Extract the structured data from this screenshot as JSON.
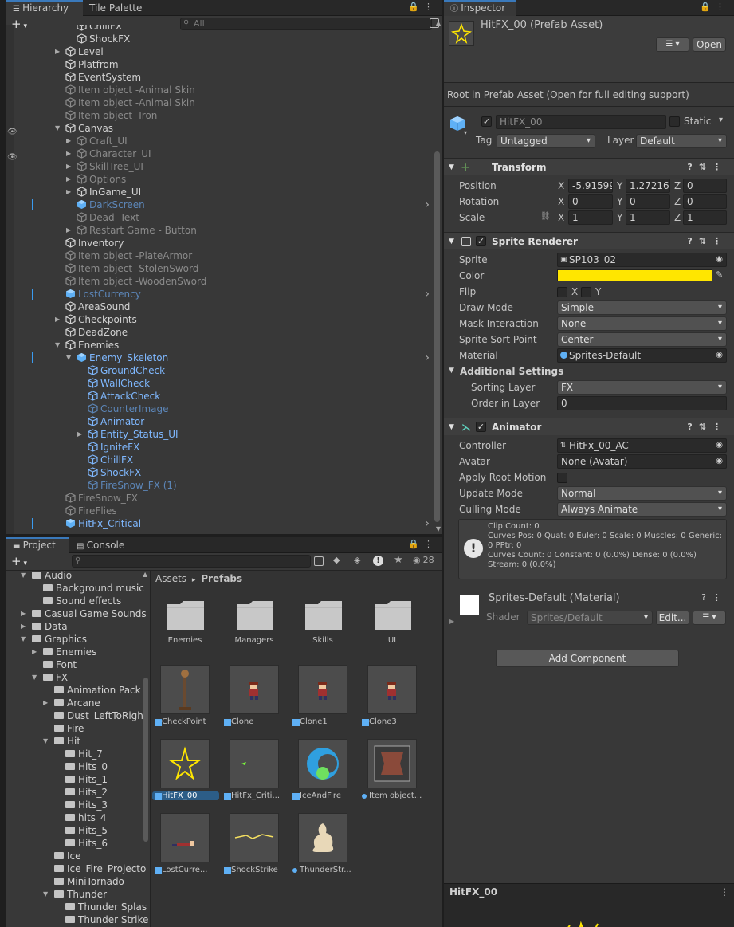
{
  "hierarchy": {
    "tabs": [
      "Hierarchy",
      "Tile Palette"
    ],
    "search_placeholder": "All",
    "items": [
      {
        "label": "ChillFX",
        "indent": 3,
        "style": "norm",
        "arrow": false
      },
      {
        "label": "ShockFX",
        "indent": 3,
        "style": "norm",
        "arrow": false
      },
      {
        "label": "Level",
        "indent": 2,
        "style": "norm",
        "arrow": true
      },
      {
        "label": "Platfrom",
        "indent": 2,
        "style": "norm",
        "arrow": false
      },
      {
        "label": "EventSystem",
        "indent": 2,
        "style": "norm",
        "arrow": false
      },
      {
        "label": "Item object -Animal Skin",
        "indent": 2,
        "style": "dim",
        "arrow": false
      },
      {
        "label": "Item object -Animal Skin",
        "indent": 2,
        "style": "dim",
        "arrow": false
      },
      {
        "label": "Item object -Iron",
        "indent": 2,
        "style": "dim",
        "arrow": false
      },
      {
        "label": "Canvas",
        "indent": 2,
        "style": "norm",
        "arrow": true,
        "open": true
      },
      {
        "label": "Craft_UI",
        "indent": 3,
        "style": "dim",
        "arrow": true
      },
      {
        "label": "Character_UI",
        "indent": 3,
        "style": "dim",
        "arrow": true
      },
      {
        "label": "SkillTree_UI",
        "indent": 3,
        "style": "dim",
        "arrow": true
      },
      {
        "label": "Options",
        "indent": 3,
        "style": "dim",
        "arrow": true
      },
      {
        "label": "InGame_UI",
        "indent": 3,
        "style": "norm",
        "arrow": true
      },
      {
        "label": "DarkScreen",
        "indent": 3,
        "style": "dimblue",
        "arrow": false,
        "prefab": true,
        "more": true
      },
      {
        "label": "Dead -Text",
        "indent": 3,
        "style": "dim",
        "arrow": false
      },
      {
        "label": "Restart  Game - Button",
        "indent": 3,
        "style": "dim",
        "arrow": true
      },
      {
        "label": "Inventory",
        "indent": 2,
        "style": "norm",
        "arrow": false
      },
      {
        "label": "Item object -PlateArmor",
        "indent": 2,
        "style": "dim",
        "arrow": false
      },
      {
        "label": "Item object -StolenSword",
        "indent": 2,
        "style": "dim",
        "arrow": false
      },
      {
        "label": "Item object -WoodenSword",
        "indent": 2,
        "style": "dim",
        "arrow": false
      },
      {
        "label": "LostCurrency",
        "indent": 2,
        "style": "dimblue",
        "arrow": false,
        "prefab": true,
        "more": true
      },
      {
        "label": "AreaSound",
        "indent": 2,
        "style": "norm",
        "arrow": false
      },
      {
        "label": "Checkpoints",
        "indent": 2,
        "style": "norm",
        "arrow": true
      },
      {
        "label": "DeadZone",
        "indent": 2,
        "style": "norm",
        "arrow": false
      },
      {
        "label": "Enemies",
        "indent": 2,
        "style": "norm",
        "arrow": true,
        "open": true
      },
      {
        "label": "Enemy_Skeleton",
        "indent": 3,
        "style": "blue",
        "arrow": true,
        "open": true,
        "prefab": true,
        "more": true
      },
      {
        "label": "GroundCheck",
        "indent": 4,
        "style": "blue",
        "arrow": false
      },
      {
        "label": "WallCheck",
        "indent": 4,
        "style": "blue",
        "arrow": false
      },
      {
        "label": "AttackCheck",
        "indent": 4,
        "style": "blue",
        "arrow": false
      },
      {
        "label": "CounterImage",
        "indent": 4,
        "style": "dimblue",
        "arrow": false
      },
      {
        "label": "Animator",
        "indent": 4,
        "style": "blue",
        "arrow": false
      },
      {
        "label": "Entity_Status_UI",
        "indent": 4,
        "style": "blue",
        "arrow": true
      },
      {
        "label": "IgniteFX",
        "indent": 4,
        "style": "blue",
        "arrow": false
      },
      {
        "label": "ChillFX",
        "indent": 4,
        "style": "blue",
        "arrow": false
      },
      {
        "label": "ShockFX",
        "indent": 4,
        "style": "blue",
        "arrow": false
      },
      {
        "label": "FireSnow_FX (1)",
        "indent": 4,
        "style": "dimblue",
        "arrow": false
      },
      {
        "label": "FireSnow_FX",
        "indent": 2,
        "style": "dim",
        "arrow": false
      },
      {
        "label": "FireFlies",
        "indent": 2,
        "style": "dim",
        "arrow": false
      },
      {
        "label": "HitFx_Critical",
        "indent": 2,
        "style": "blue",
        "arrow": false,
        "prefab": true,
        "more": true
      }
    ]
  },
  "project": {
    "tabs": [
      "Project",
      "Console"
    ],
    "hidden_count": "28",
    "breadcrumb": [
      "Assets",
      "Prefabs"
    ],
    "tree": [
      {
        "label": "Audio",
        "indent": 1,
        "arrow": "open"
      },
      {
        "label": "Background music",
        "indent": 2,
        "arrow": "none"
      },
      {
        "label": "Sound effects",
        "indent": 2,
        "arrow": "none"
      },
      {
        "label": "Casual Game Sounds",
        "indent": 1,
        "arrow": "closed"
      },
      {
        "label": "Data",
        "indent": 1,
        "arrow": "closed"
      },
      {
        "label": "Graphics",
        "indent": 1,
        "arrow": "open"
      },
      {
        "label": "Enemies",
        "indent": 2,
        "arrow": "closed"
      },
      {
        "label": "Font",
        "indent": 2,
        "arrow": "none"
      },
      {
        "label": "FX",
        "indent": 2,
        "arrow": "open"
      },
      {
        "label": "Animation Pack",
        "indent": 3,
        "arrow": "none"
      },
      {
        "label": "Arcane",
        "indent": 3,
        "arrow": "closed"
      },
      {
        "label": "Dust_LeftToRigh",
        "indent": 3,
        "arrow": "none"
      },
      {
        "label": "Fire",
        "indent": 3,
        "arrow": "none"
      },
      {
        "label": "Hit",
        "indent": 3,
        "arrow": "open"
      },
      {
        "label": "Hit_7",
        "indent": 4,
        "arrow": "none"
      },
      {
        "label": "Hits_0",
        "indent": 4,
        "arrow": "none"
      },
      {
        "label": "Hits_1",
        "indent": 4,
        "arrow": "none"
      },
      {
        "label": "Hits_2",
        "indent": 4,
        "arrow": "none"
      },
      {
        "label": "Hits_3",
        "indent": 4,
        "arrow": "none"
      },
      {
        "label": "hits_4",
        "indent": 4,
        "arrow": "none"
      },
      {
        "label": "Hits_5",
        "indent": 4,
        "arrow": "none"
      },
      {
        "label": "Hits_6",
        "indent": 4,
        "arrow": "none"
      },
      {
        "label": "Ice",
        "indent": 3,
        "arrow": "none"
      },
      {
        "label": "Ice_Fire_Projecto",
        "indent": 3,
        "arrow": "none"
      },
      {
        "label": "MiniTornado",
        "indent": 3,
        "arrow": "none"
      },
      {
        "label": "Thunder",
        "indent": 3,
        "arrow": "open"
      },
      {
        "label": "Thunder Splas",
        "indent": 4,
        "arrow": "none"
      },
      {
        "label": "Thunder Strike",
        "indent": 4,
        "arrow": "none"
      }
    ],
    "folders": [
      "Enemies",
      "Managers",
      "Skills",
      "UI"
    ],
    "assets": [
      {
        "label": "CheckPoint",
        "art": "checkpoint",
        "icon": "cube"
      },
      {
        "label": "Clone",
        "art": "char",
        "icon": "cube"
      },
      {
        "label": "Clone1",
        "art": "char",
        "icon": "cube"
      },
      {
        "label": "Clone3",
        "art": "char",
        "icon": "cube"
      },
      {
        "label": "HitFX_00",
        "art": "star",
        "icon": "cube",
        "selected": true
      },
      {
        "label": "HitFx_Criti...",
        "art": "spark",
        "icon": "cube"
      },
      {
        "label": "IceAndFire",
        "art": "swirl",
        "icon": "cube"
      },
      {
        "label": "Item object...",
        "art": "pelt",
        "icon": "dot"
      },
      {
        "label": "LostCurre...",
        "art": "fallen",
        "icon": "cube"
      },
      {
        "label": "ShockStrike",
        "art": "bolt",
        "icon": "cube"
      },
      {
        "label": "ThunderStr...",
        "art": "ghost",
        "icon": "dot"
      }
    ]
  },
  "inspector": {
    "tab": "Inspector",
    "asset_title": "HitFX_00 (Prefab Asset)",
    "open_label": "Open",
    "root_note": "Root in Prefab Asset (Open for full editing support)",
    "object_name": "HitFX_00",
    "static_label": "Static",
    "tag_label": "Tag",
    "tag_value": "Untagged",
    "layer_label": "Layer",
    "layer_value": "Default",
    "transform": {
      "title": "Transform",
      "position_label": "Position",
      "pos_x": "-5.91599",
      "pos_y": "1.272164",
      "pos_z": "0",
      "rotation_label": "Rotation",
      "rot_x": "0",
      "rot_y": "0",
      "rot_z": "0",
      "scale_label": "Scale",
      "scale_x": "1",
      "scale_y": "1",
      "scale_z": "1",
      "x": "X",
      "y": "Y",
      "z": "Z"
    },
    "sprite_renderer": {
      "title": "Sprite Renderer",
      "sprite_label": "Sprite",
      "sprite_value": "SP103_02",
      "color_label": "Color",
      "color_value": "#ffe600",
      "flip_label": "Flip",
      "flip_x": "X",
      "flip_y": "Y",
      "draw_mode_label": "Draw Mode",
      "draw_mode_value": "Simple",
      "mask_label": "Mask Interaction",
      "mask_value": "None",
      "sort_point_label": "Sprite Sort Point",
      "sort_point_value": "Center",
      "material_label": "Material",
      "material_value": "Sprites-Default",
      "additional_label": "Additional Settings",
      "sorting_layer_label": "Sorting Layer",
      "sorting_layer_value": "FX",
      "order_label": "Order in Layer",
      "order_value": "0"
    },
    "animator": {
      "title": "Animator",
      "controller_label": "Controller",
      "controller_value": "HitFx_00_AC",
      "avatar_label": "Avatar",
      "avatar_value": "None (Avatar)",
      "root_motion_label": "Apply Root Motion",
      "update_label": "Update Mode",
      "update_value": "Normal",
      "culling_label": "Culling Mode",
      "culling_value": "Always Animate",
      "info": "Clip Count: 0\nCurves Pos: 0 Quat: 0 Euler: 0 Scale: 0 Muscles: 0 Generic: 0 PPtr: 0\nCurves Count: 0 Constant: 0 (0.0%) Dense: 0 (0.0%) Stream: 0 (0.0%)"
    },
    "material": {
      "title": "Sprites-Default (Material)",
      "shader_label": "Shader",
      "shader_value": "Sprites/Default",
      "edit_label": "Edit..."
    },
    "add_component": "Add Component",
    "preview_title": "HitFX_00"
  }
}
